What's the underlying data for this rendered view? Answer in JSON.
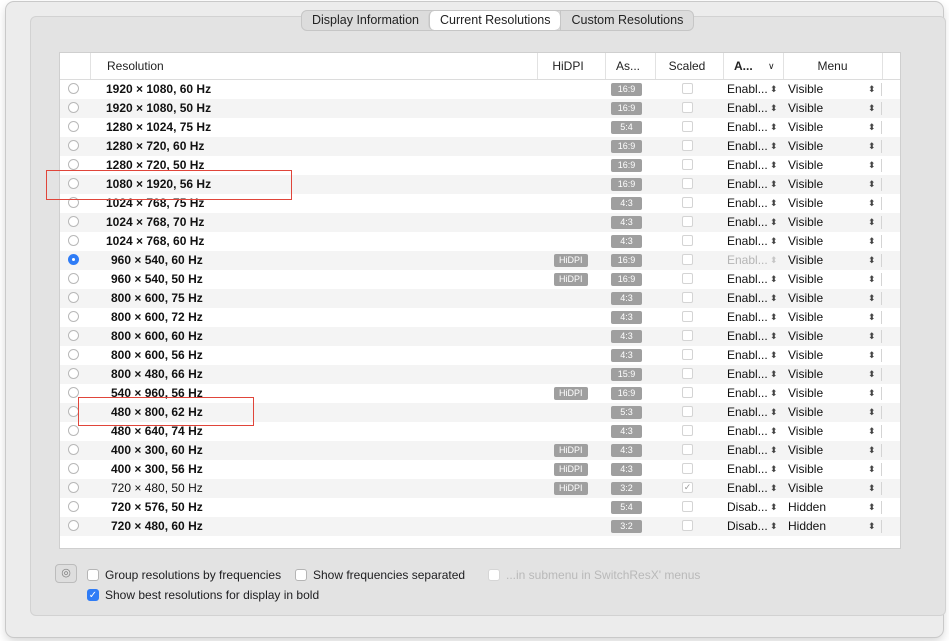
{
  "tabs": [
    "Display Information",
    "Current Resolutions",
    "Custom Resolutions"
  ],
  "active_tab": 1,
  "columns": {
    "resolution": "Resolution",
    "hidpi": "HiDPI",
    "aspect": "As...",
    "scaled": "Scaled",
    "availability": "A...",
    "menu": "Menu"
  },
  "rows": [
    {
      "res": "1920 × 1080, 60 Hz",
      "hidpi": "",
      "aspect": "16:9",
      "scaled": false,
      "avail": "Enabl...",
      "menu": "Visible",
      "selected": false,
      "bold": true,
      "indent": false
    },
    {
      "res": "1920 × 1080, 50 Hz",
      "hidpi": "",
      "aspect": "16:9",
      "scaled": false,
      "avail": "Enabl...",
      "menu": "Visible",
      "selected": false,
      "bold": true,
      "indent": false
    },
    {
      "res": "1280 × 1024, 75 Hz",
      "hidpi": "",
      "aspect": "5:4",
      "scaled": false,
      "avail": "Enabl...",
      "menu": "Visible",
      "selected": false,
      "bold": true,
      "indent": false
    },
    {
      "res": "1280 × 720, 60 Hz",
      "hidpi": "",
      "aspect": "16:9",
      "scaled": false,
      "avail": "Enabl...",
      "menu": "Visible",
      "selected": false,
      "bold": true,
      "indent": false
    },
    {
      "res": "1280 × 720, 50 Hz",
      "hidpi": "",
      "aspect": "16:9",
      "scaled": false,
      "avail": "Enabl...",
      "menu": "Visible",
      "selected": false,
      "bold": true,
      "indent": false
    },
    {
      "res": "1080 × 1920, 56 Hz",
      "hidpi": "",
      "aspect": "16:9",
      "scaled": false,
      "avail": "Enabl...",
      "menu": "Visible",
      "selected": false,
      "bold": true,
      "indent": false
    },
    {
      "res": "1024 × 768, 75 Hz",
      "hidpi": "",
      "aspect": "4:3",
      "scaled": false,
      "avail": "Enabl...",
      "menu": "Visible",
      "selected": false,
      "bold": true,
      "indent": false
    },
    {
      "res": "1024 × 768, 70 Hz",
      "hidpi": "",
      "aspect": "4:3",
      "scaled": false,
      "avail": "Enabl...",
      "menu": "Visible",
      "selected": false,
      "bold": true,
      "indent": false
    },
    {
      "res": "1024 × 768, 60 Hz",
      "hidpi": "",
      "aspect": "4:3",
      "scaled": false,
      "avail": "Enabl...",
      "menu": "Visible",
      "selected": false,
      "bold": true,
      "indent": false
    },
    {
      "res": "960 × 540, 60 Hz",
      "hidpi": "HiDPI",
      "aspect": "16:9",
      "scaled": false,
      "avail": "Enabl...",
      "menu": "Visible",
      "selected": true,
      "bold": true,
      "indent": true,
      "avail_dim": true
    },
    {
      "res": "960 × 540, 50 Hz",
      "hidpi": "HiDPI",
      "aspect": "16:9",
      "scaled": false,
      "avail": "Enabl...",
      "menu": "Visible",
      "selected": false,
      "bold": true,
      "indent": true
    },
    {
      "res": "800 × 600, 75 Hz",
      "hidpi": "",
      "aspect": "4:3",
      "scaled": false,
      "avail": "Enabl...",
      "menu": "Visible",
      "selected": false,
      "bold": true,
      "indent": true
    },
    {
      "res": "800 × 600, 72 Hz",
      "hidpi": "",
      "aspect": "4:3",
      "scaled": false,
      "avail": "Enabl...",
      "menu": "Visible",
      "selected": false,
      "bold": true,
      "indent": true
    },
    {
      "res": "800 × 600, 60 Hz",
      "hidpi": "",
      "aspect": "4:3",
      "scaled": false,
      "avail": "Enabl...",
      "menu": "Visible",
      "selected": false,
      "bold": true,
      "indent": true
    },
    {
      "res": "800 × 600, 56 Hz",
      "hidpi": "",
      "aspect": "4:3",
      "scaled": false,
      "avail": "Enabl...",
      "menu": "Visible",
      "selected": false,
      "bold": true,
      "indent": true
    },
    {
      "res": "800 × 480, 66 Hz",
      "hidpi": "",
      "aspect": "15:9",
      "scaled": false,
      "avail": "Enabl...",
      "menu": "Visible",
      "selected": false,
      "bold": true,
      "indent": true
    },
    {
      "res": "540 × 960, 56 Hz",
      "hidpi": "HiDPI",
      "aspect": "16:9",
      "scaled": false,
      "avail": "Enabl...",
      "menu": "Visible",
      "selected": false,
      "bold": true,
      "indent": true
    },
    {
      "res": "480 × 800, 62 Hz",
      "hidpi": "",
      "aspect": "5:3",
      "scaled": false,
      "avail": "Enabl...",
      "menu": "Visible",
      "selected": false,
      "bold": true,
      "indent": true
    },
    {
      "res": "480 × 640, 74 Hz",
      "hidpi": "",
      "aspect": "4:3",
      "scaled": false,
      "avail": "Enabl...",
      "menu": "Visible",
      "selected": false,
      "bold": true,
      "indent": true
    },
    {
      "res": "400 × 300, 60 Hz",
      "hidpi": "HiDPI",
      "aspect": "4:3",
      "scaled": false,
      "avail": "Enabl...",
      "menu": "Visible",
      "selected": false,
      "bold": true,
      "indent": true
    },
    {
      "res": "400 × 300, 56 Hz",
      "hidpi": "HiDPI",
      "aspect": "4:3",
      "scaled": false,
      "avail": "Enabl...",
      "menu": "Visible",
      "selected": false,
      "bold": true,
      "indent": true
    },
    {
      "res": "720 × 480, 50 Hz",
      "hidpi": "HiDPI",
      "aspect": "3:2",
      "scaled": true,
      "avail": "Enabl...",
      "menu": "Visible",
      "selected": false,
      "bold": false,
      "indent": true
    },
    {
      "res": "720 × 576, 50 Hz",
      "hidpi": "",
      "aspect": "5:4",
      "scaled": false,
      "avail": "Disab...",
      "menu": "Hidden",
      "selected": false,
      "bold": true,
      "indent": true
    },
    {
      "res": "720 × 480, 60 Hz",
      "hidpi": "",
      "aspect": "3:2",
      "scaled": false,
      "avail": "Disab...",
      "menu": "Hidden",
      "selected": false,
      "bold": true,
      "indent": true
    }
  ],
  "options": {
    "eye_icon": "eye-icon",
    "group_by_freq": {
      "label": "Group resolutions by frequencies",
      "checked": false
    },
    "show_freq_separated": {
      "label": "Show frequencies separated",
      "checked": false
    },
    "in_submenu": {
      "label": "...in submenu in SwitchResX' menus",
      "checked": false,
      "disabled": true
    },
    "show_best_bold": {
      "label": "Show best resolutions for display in bold",
      "checked": true
    }
  },
  "highlight_color": "#e0453a",
  "accent_color": "#2f7cf6"
}
